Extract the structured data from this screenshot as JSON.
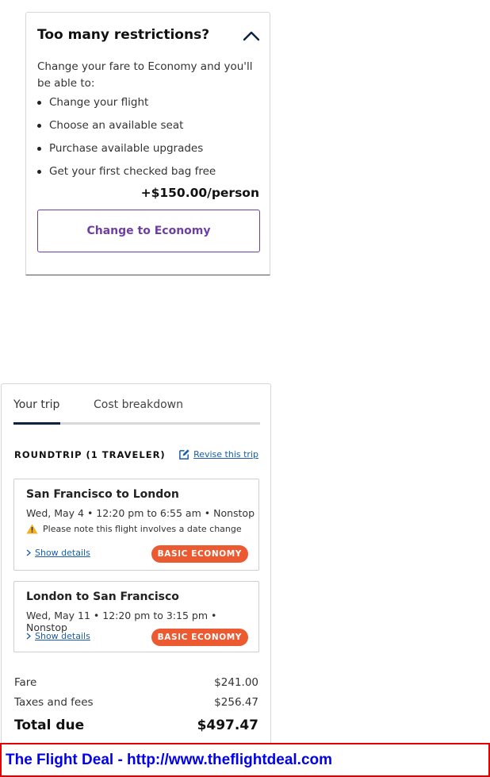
{
  "upsell": {
    "title": "Too many restrictions?",
    "toggle_icon": "chevron-up-icon",
    "intro": "Change your fare to Economy and you'll be able to:",
    "benefits": [
      "Change your flight",
      "Choose an available seat",
      "Purchase available upgrades",
      "Get your first checked bag free"
    ],
    "price": "+$150.00/person",
    "button_label": "Change to Economy"
  },
  "trip": {
    "tabs": [
      "Your trip",
      "Cost breakdown"
    ],
    "active_tab": "Your trip",
    "trip_type": "ROUNDTRIP (1 TRAVELER)",
    "revise_label": "Revise this trip",
    "revise_icon": "edit-icon",
    "flights": [
      {
        "route": "San Francisco to London",
        "schedule": "Wed, May 4 • 12:20 pm to 6:55 am • Nonstop",
        "warning": "Please note this flight involves a date change",
        "details_label": "Show details",
        "fare_class": "BASIC ECONOMY"
      },
      {
        "route": "London to San Francisco",
        "schedule": "Wed, May 11 • 12:20 pm to 3:15 pm • Nonstop",
        "details_label": "Show details",
        "fare_class": "BASIC ECONOMY"
      }
    ],
    "costs": {
      "fare_label": "Fare",
      "fare_value": "$241.00",
      "taxes_label": "Taxes and fees",
      "taxes_value": "$256.47",
      "total_label": "Total due",
      "total_value": "$497.47"
    }
  },
  "banner": {
    "text": "The Flight Deal - http://www.theflightdeal.com"
  },
  "colors": {
    "accent_purple": "#6e3fa3",
    "badge_orange": "#ec5a32",
    "link_blue": "#1a5ea6",
    "navy": "#0c2340",
    "banner_red": "#e00000",
    "banner_text_blue": "#0000ee"
  }
}
